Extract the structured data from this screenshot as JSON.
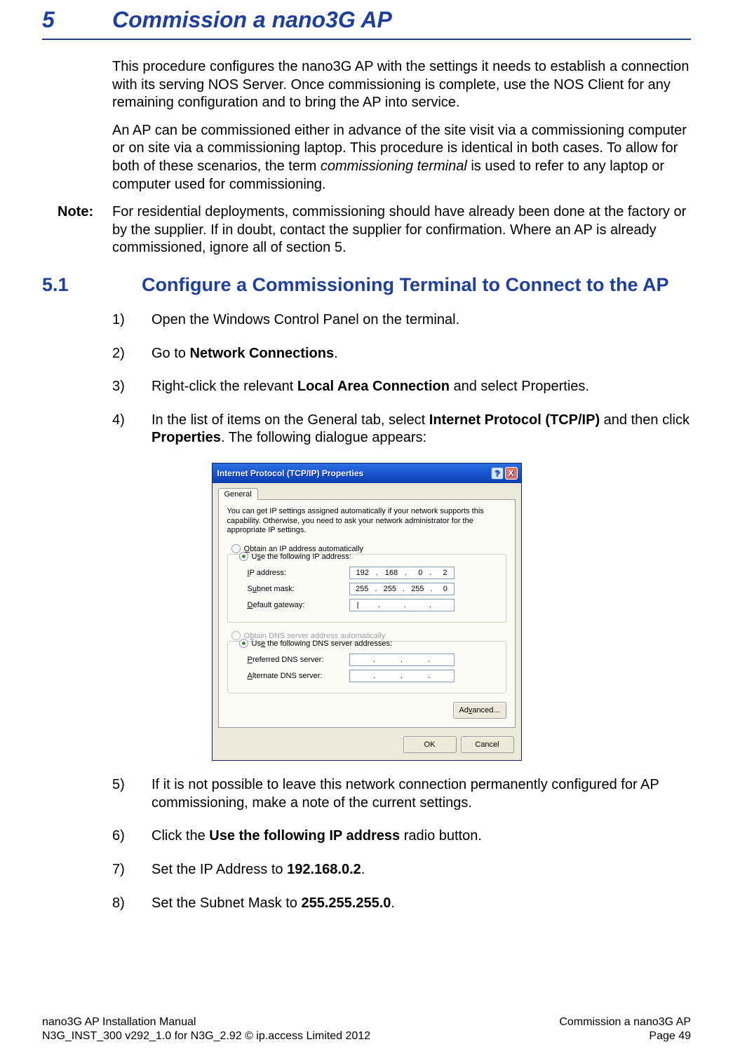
{
  "chapter": {
    "num": "5",
    "title": "Commission a nano3G AP"
  },
  "intro": {
    "p1": "This procedure configures the nano3G AP with the settings it needs to establish a connection with its serving NOS Server. Once commissioning is complete, use the NOS Client for any remaining configuration and to bring the AP into service.",
    "p2a": "An AP can be commissioned either in advance of the site visit via a commissioning computer or on site via a commissioning laptop. This procedure is identical in both cases. To allow for both of these scenarios, the term ",
    "p2i": "commissioning terminal",
    "p2b": " is used to refer to any laptop or computer used for commissioning."
  },
  "note": {
    "label": "Note:",
    "body": "For residential deployments, commissioning should have already been done at the factory or by the supplier. If in doubt, contact the supplier for confirmation. Where an AP is already commissioned, ignore all of section 5."
  },
  "section": {
    "num": "5.1",
    "title": "Configure a Commissioning Terminal to Connect to the AP"
  },
  "steps": {
    "s1": {
      "n": "1)",
      "t": "Open the Windows Control Panel on the terminal."
    },
    "s2": {
      "n": "2)",
      "a": "Go to ",
      "b": "Network Connections",
      "c": "."
    },
    "s3": {
      "n": "3)",
      "a": "Right-click the relevant ",
      "b": "Local Area Connection",
      "c": " and select Properties."
    },
    "s4": {
      "n": "4)",
      "a": "In the list of items on the General tab, select ",
      "b": "Internet Protocol (TCP/IP)",
      "c": " and then click ",
      "d": "Properties",
      "e": ". The following dialogue appears:"
    },
    "s5": {
      "n": "5)",
      "t": "If it is not possible to leave this network connection permanently configured for AP commissioning, make a note of the current settings."
    },
    "s6": {
      "n": "6)",
      "a": "Click the ",
      "b": "Use the following IP address",
      "c": " radio button."
    },
    "s7": {
      "n": "7)",
      "a": "Set the IP Address to ",
      "b": "192.168.0.2",
      "c": "."
    },
    "s8": {
      "n": "8)",
      "a": "Set the Subnet Mask to ",
      "b": "255.255.255.0",
      "c": "."
    }
  },
  "dialog": {
    "title": "Internet Protocol (TCP/IP) Properties",
    "help": "?",
    "close": "X",
    "tab": "General",
    "desc": "You can get IP settings assigned automatically if your network supports this capability. Otherwise, you need to ask your network administrator for the appropriate IP settings.",
    "r1": "Obtain an IP address automatically",
    "r2": "Use the following IP address:",
    "f_ip": "IP address:",
    "f_sub": "Subnet mask:",
    "f_gw": "Default gateway:",
    "r3": "Obtain DNS server address automatically",
    "r4": "Use the following DNS server addresses:",
    "f_pdns": "Preferred DNS server:",
    "f_adns": "Alternate DNS server:",
    "ip": {
      "a": "192",
      "b": "168",
      "c": "0",
      "d": "2"
    },
    "sm": {
      "a": "255",
      "b": "255",
      "c": "255",
      "d": "0"
    },
    "gw_cursor": "|",
    "adv": "Advanced...",
    "ok": "OK",
    "cancel": "Cancel"
  },
  "footer": {
    "l1": "nano3G AP Installation Manual",
    "l2": "N3G_INST_300 v292_1.0 for N3G_2.92 © ip.access Limited 2012",
    "r1": "Commission a nano3G AP",
    "r2": "Page 49"
  }
}
